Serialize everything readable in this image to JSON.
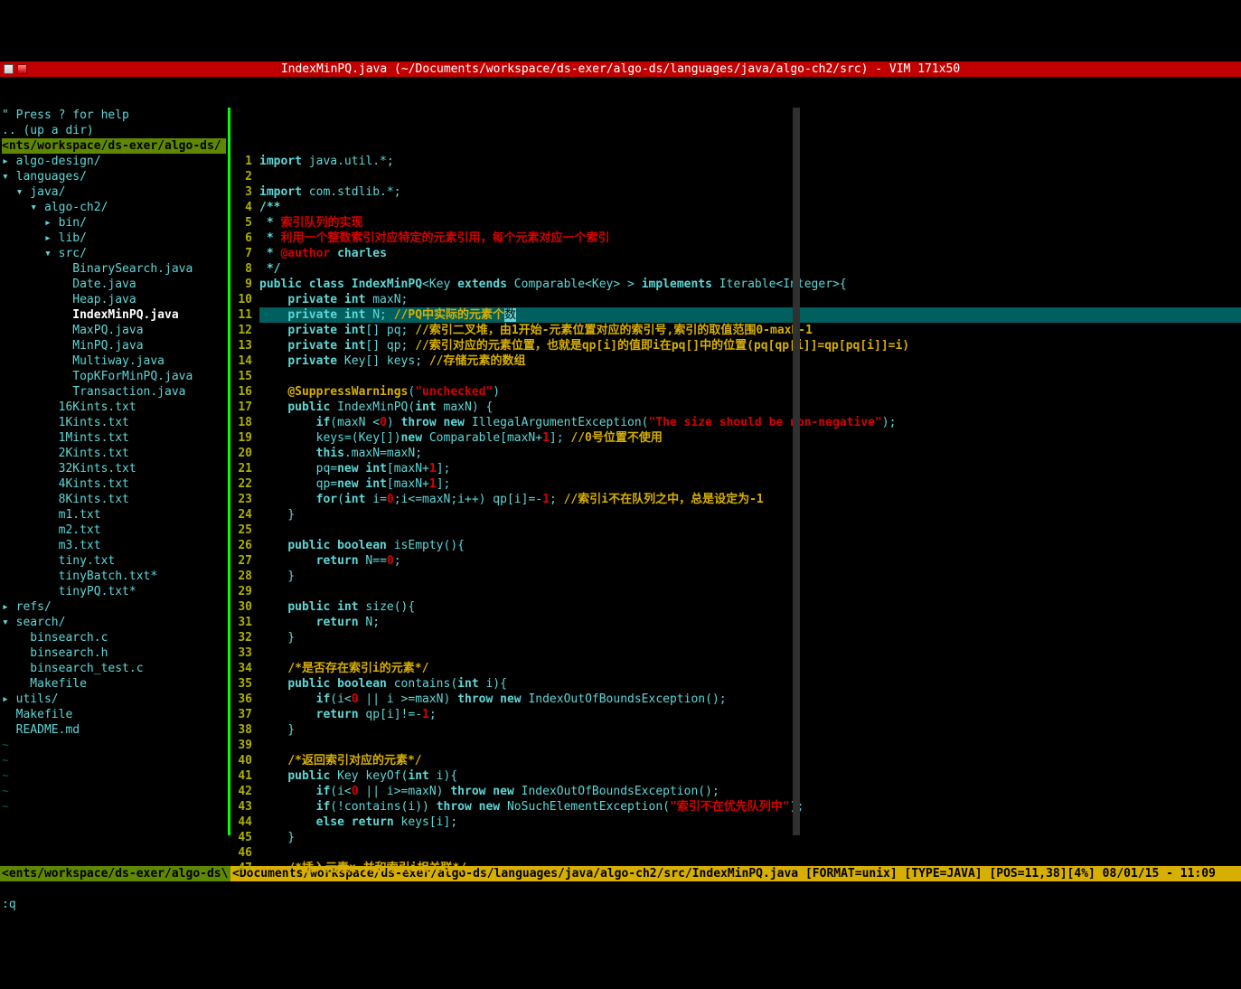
{
  "title": "IndexMinPQ.java (~/Documents/workspace/ds-exer/algo-ds/languages/java/algo-ch2/src) - VIM 171x50",
  "tree": {
    "help": "\" Press ? for help",
    "up": ".. (up a dir)",
    "root": "<nts/workspace/ds-exer/algo-ds/",
    "items": [
      "▸ algo-design/",
      "▾ languages/",
      "  ▾ java/",
      "    ▾ algo-ch2/",
      "      ▸ bin/",
      "      ▸ lib/",
      "      ▾ src/",
      "          BinarySearch.java",
      "          Date.java",
      "          Heap.java",
      "          IndexMinPQ.java",
      "          MaxPQ.java",
      "          MinPQ.java",
      "          Multiway.java",
      "          TopKForMinPQ.java",
      "          Transaction.java",
      "        16Kints.txt",
      "        1Kints.txt",
      "        1Mints.txt",
      "        2Kints.txt",
      "        32Kints.txt",
      "        4Kints.txt",
      "        8Kints.txt",
      "        m1.txt",
      "        m2.txt",
      "        m3.txt",
      "        tiny.txt",
      "        tinyBatch.txt*",
      "        tinyPQ.txt*",
      "▸ refs/",
      "▾ search/",
      "    binsearch.c",
      "    binsearch.h",
      "    binsearch_test.c",
      "    Makefile",
      "▸ utils/",
      "  Makefile",
      "  README.md"
    ],
    "sel_index": 10
  },
  "code": [
    {
      "n": 1,
      "seg": [
        [
          "kw",
          "import"
        ],
        [
          "id",
          " java.util.*;"
        ]
      ]
    },
    {
      "n": 2,
      "seg": []
    },
    {
      "n": 3,
      "seg": [
        [
          "kw",
          "import"
        ],
        [
          "id",
          " com.stdlib.*;"
        ]
      ]
    },
    {
      "n": 4,
      "seg": [
        [
          "jd",
          "/**"
        ]
      ]
    },
    {
      "n": 5,
      "seg": [
        [
          "jd",
          " * "
        ],
        [
          "jdr",
          "索引队列的实现"
        ]
      ]
    },
    {
      "n": 6,
      "seg": [
        [
          "jd",
          " * "
        ],
        [
          "jdr",
          "利用一个整数索引对应特定的元素引用，每个元素对应一个索引"
        ]
      ]
    },
    {
      "n": 7,
      "seg": [
        [
          "jd",
          " * "
        ],
        [
          "author",
          "@author"
        ],
        [
          "jd",
          " charles"
        ]
      ]
    },
    {
      "n": 8,
      "seg": [
        [
          "jd",
          " */"
        ]
      ]
    },
    {
      "n": 9,
      "seg": [
        [
          "kw",
          "public class "
        ],
        [
          "fn",
          "IndexMinPQ"
        ],
        [
          "id",
          "<Key "
        ],
        [
          "kw",
          "extends"
        ],
        [
          "id",
          " Comparable<Key> > "
        ],
        [
          "kw",
          "implements"
        ],
        [
          "id",
          " Iterable<Integer>{"
        ]
      ]
    },
    {
      "n": 10,
      "seg": [
        [
          "id",
          "    "
        ],
        [
          "kw",
          "private int"
        ],
        [
          "id",
          " maxN;"
        ]
      ]
    },
    {
      "n": 11,
      "cur": true,
      "seg": [
        [
          "id",
          "    "
        ],
        [
          "kw",
          "private int"
        ],
        [
          "id",
          " N; "
        ],
        [
          "cmt",
          "//PQ中实际的元素个"
        ],
        [
          "cursor",
          "数"
        ]
      ]
    },
    {
      "n": 12,
      "seg": [
        [
          "id",
          "    "
        ],
        [
          "kw",
          "private int"
        ],
        [
          "id",
          "[] pq; "
        ],
        [
          "cmt",
          "//索引二叉堆，由1开始-元素位置对应的索引号,索引的取值范围0-maxN-1"
        ]
      ]
    },
    {
      "n": 13,
      "seg": [
        [
          "id",
          "    "
        ],
        [
          "kw",
          "private int"
        ],
        [
          "id",
          "[] qp; "
        ],
        [
          "cmt",
          "//索引对应的元素位置，也就是qp[i]的值即i在pq[]中的位置(pq[qp[i]]=qp[pq[i]]=i)"
        ]
      ]
    },
    {
      "n": 14,
      "seg": [
        [
          "id",
          "    "
        ],
        [
          "kw",
          "private"
        ],
        [
          "id",
          " Key[] keys; "
        ],
        [
          "cmt",
          "//存储元素的数组"
        ]
      ]
    },
    {
      "n": 15,
      "seg": []
    },
    {
      "n": 16,
      "seg": [
        [
          "id",
          "    "
        ],
        [
          "ann",
          "@SuppressWarnings"
        ],
        [
          "id",
          "("
        ],
        [
          "str",
          "\"unchecked\""
        ],
        [
          "id",
          ")"
        ]
      ]
    },
    {
      "n": 17,
      "seg": [
        [
          "id",
          "    "
        ],
        [
          "kw",
          "public"
        ],
        [
          "id",
          " IndexMinPQ("
        ],
        [
          "kw",
          "int"
        ],
        [
          "id",
          " maxN) {"
        ]
      ]
    },
    {
      "n": 18,
      "seg": [
        [
          "id",
          "        "
        ],
        [
          "kw",
          "if"
        ],
        [
          "id",
          "(maxN <"
        ],
        [
          "num",
          "0"
        ],
        [
          "id",
          ") "
        ],
        [
          "kw",
          "throw new"
        ],
        [
          "id",
          " IllegalArgumentException("
        ],
        [
          "str",
          "\"The size should be non-negative\""
        ],
        [
          "id",
          ");"
        ]
      ]
    },
    {
      "n": 19,
      "seg": [
        [
          "id",
          "        keys=(Key[])"
        ],
        [
          "kw",
          "new"
        ],
        [
          "id",
          " Comparable[maxN+"
        ],
        [
          "num",
          "1"
        ],
        [
          "id",
          "]; "
        ],
        [
          "cmt",
          "//0号位置不使用"
        ]
      ]
    },
    {
      "n": 20,
      "seg": [
        [
          "id",
          "        "
        ],
        [
          "kw",
          "this"
        ],
        [
          "id",
          ".maxN=maxN;"
        ]
      ]
    },
    {
      "n": 21,
      "seg": [
        [
          "id",
          "        pq="
        ],
        [
          "kw",
          "new int"
        ],
        [
          "id",
          "[maxN+"
        ],
        [
          "num",
          "1"
        ],
        [
          "id",
          "];"
        ]
      ]
    },
    {
      "n": 22,
      "seg": [
        [
          "id",
          "        qp="
        ],
        [
          "kw",
          "new int"
        ],
        [
          "id",
          "[maxN+"
        ],
        [
          "num",
          "1"
        ],
        [
          "id",
          "];"
        ]
      ]
    },
    {
      "n": 23,
      "seg": [
        [
          "id",
          "        "
        ],
        [
          "kw",
          "for"
        ],
        [
          "id",
          "("
        ],
        [
          "kw",
          "int"
        ],
        [
          "id",
          " i="
        ],
        [
          "num",
          "0"
        ],
        [
          "id",
          ";i<=maxN;i++) qp[i]=-"
        ],
        [
          "num",
          "1"
        ],
        [
          "id",
          "; "
        ],
        [
          "cmt",
          "//索引i不在队列之中，总是设定为-1"
        ]
      ]
    },
    {
      "n": 24,
      "seg": [
        [
          "id",
          "    }"
        ]
      ]
    },
    {
      "n": 25,
      "seg": []
    },
    {
      "n": 26,
      "seg": [
        [
          "id",
          "    "
        ],
        [
          "kw",
          "public boolean"
        ],
        [
          "id",
          " isEmpty(){"
        ]
      ]
    },
    {
      "n": 27,
      "seg": [
        [
          "id",
          "        "
        ],
        [
          "kw",
          "return"
        ],
        [
          "id",
          " N=="
        ],
        [
          "num",
          "0"
        ],
        [
          "id",
          ";"
        ]
      ]
    },
    {
      "n": 28,
      "seg": [
        [
          "id",
          "    }"
        ]
      ]
    },
    {
      "n": 29,
      "seg": []
    },
    {
      "n": 30,
      "seg": [
        [
          "id",
          "    "
        ],
        [
          "kw",
          "public int"
        ],
        [
          "id",
          " size(){"
        ]
      ]
    },
    {
      "n": 31,
      "seg": [
        [
          "id",
          "        "
        ],
        [
          "kw",
          "return"
        ],
        [
          "id",
          " N;"
        ]
      ]
    },
    {
      "n": 32,
      "seg": [
        [
          "id",
          "    }"
        ]
      ]
    },
    {
      "n": 33,
      "seg": []
    },
    {
      "n": 34,
      "seg": [
        [
          "id",
          "    "
        ],
        [
          "cmt",
          "/*是否存在索引i的元素*/"
        ]
      ]
    },
    {
      "n": 35,
      "seg": [
        [
          "id",
          "    "
        ],
        [
          "kw",
          "public boolean"
        ],
        [
          "id",
          " contains("
        ],
        [
          "kw",
          "int"
        ],
        [
          "id",
          " i){"
        ]
      ]
    },
    {
      "n": 36,
      "seg": [
        [
          "id",
          "        "
        ],
        [
          "kw",
          "if"
        ],
        [
          "id",
          "(i<"
        ],
        [
          "num",
          "0"
        ],
        [
          "id",
          " || i >=maxN) "
        ],
        [
          "kw",
          "throw new"
        ],
        [
          "id",
          " IndexOutOfBoundsException();"
        ]
      ]
    },
    {
      "n": 37,
      "seg": [
        [
          "id",
          "        "
        ],
        [
          "kw",
          "return"
        ],
        [
          "id",
          " qp[i]!=-"
        ],
        [
          "num",
          "1"
        ],
        [
          "id",
          ";"
        ]
      ]
    },
    {
      "n": 38,
      "seg": [
        [
          "id",
          "    }"
        ]
      ]
    },
    {
      "n": 39,
      "seg": []
    },
    {
      "n": 40,
      "seg": [
        [
          "id",
          "    "
        ],
        [
          "cmt",
          "/*返回索引对应的元素*/"
        ]
      ]
    },
    {
      "n": 41,
      "seg": [
        [
          "id",
          "    "
        ],
        [
          "kw",
          "public"
        ],
        [
          "id",
          " Key keyOf("
        ],
        [
          "kw",
          "int"
        ],
        [
          "id",
          " i){"
        ]
      ]
    },
    {
      "n": 42,
      "seg": [
        [
          "id",
          "        "
        ],
        [
          "kw",
          "if"
        ],
        [
          "id",
          "(i<"
        ],
        [
          "num",
          "0"
        ],
        [
          "id",
          " || i>=maxN) "
        ],
        [
          "kw",
          "throw new"
        ],
        [
          "id",
          " IndexOutOfBoundsException();"
        ]
      ]
    },
    {
      "n": 43,
      "seg": [
        [
          "id",
          "        "
        ],
        [
          "kw",
          "if"
        ],
        [
          "id",
          "(!contains(i)) "
        ],
        [
          "kw",
          "throw new"
        ],
        [
          "id",
          " NoSuchElementException("
        ],
        [
          "str",
          "\"索引不在优先队列中\""
        ],
        [
          "id",
          ");"
        ]
      ]
    },
    {
      "n": 44,
      "seg": [
        [
          "id",
          "        "
        ],
        [
          "kw",
          "else return"
        ],
        [
          "id",
          " keys[i];"
        ]
      ]
    },
    {
      "n": 45,
      "seg": [
        [
          "id",
          "    }"
        ]
      ]
    },
    {
      "n": 46,
      "seg": []
    },
    {
      "n": 47,
      "seg": [
        [
          "id",
          "    "
        ],
        [
          "cmt",
          "/*插入元素x,并和索引i相关联*/"
        ]
      ]
    }
  ],
  "status": {
    "left": "<ents/workspace/ds-exer/algo-ds\\",
    "right": "<Documents/workspace/ds-exer/algo-ds/languages/java/algo-ch2/src/IndexMinPQ.java [FORMAT=unix] [TYPE=JAVA] [POS=11,38][4%] 08/01/15 - 11:09"
  },
  "cmd": ":q"
}
